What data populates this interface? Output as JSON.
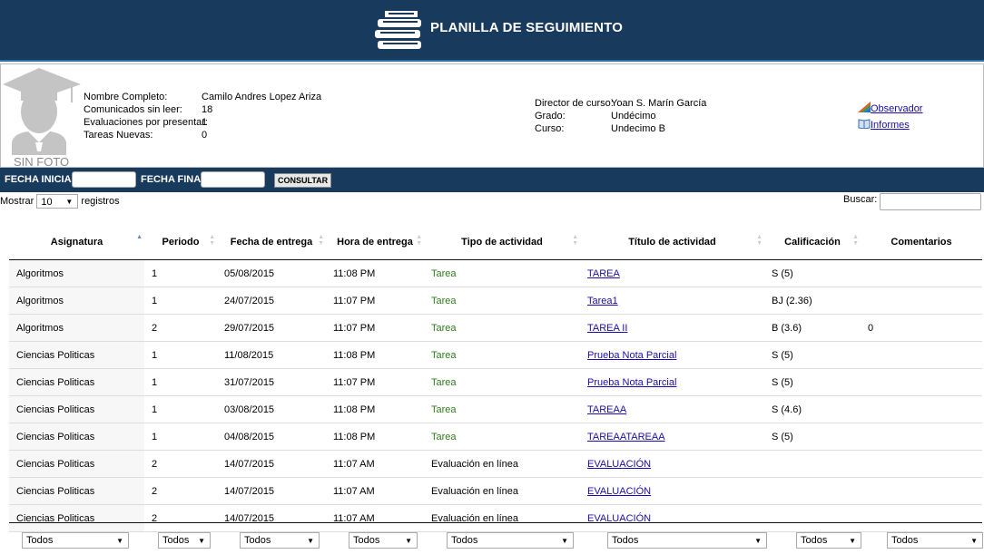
{
  "header": {
    "title": "PLANILLA DE SEGUIMIENTO",
    "logo_icon": "stacked-books-icon"
  },
  "student": {
    "photo_caption": "SIN FOTO",
    "fields": [
      {
        "label": "Nombre Completo:",
        "value": "Camilo Andres Lopez Ariza"
      },
      {
        "label": "Comunicados sin leer:",
        "value": "18"
      },
      {
        "label": "Evaluaciones por presentar:",
        "value": "1"
      },
      {
        "label": "Tareas Nuevas:",
        "value": "0"
      }
    ]
  },
  "course": {
    "fields": [
      {
        "label": "Director de curso:",
        "value": "Yoan S. Marín García"
      },
      {
        "label": "Grado:",
        "value": "Undécimo"
      },
      {
        "label": "Curso:",
        "value": "Undecimo B"
      }
    ]
  },
  "links": {
    "observador": "Observador",
    "informes": "Informes"
  },
  "filters": {
    "fecha_inicial_label": "FECHA INICIAL:",
    "fecha_final_label": "FECHA FINAL:",
    "fecha_inicial_value": "",
    "fecha_final_value": "",
    "consultar_label": "CONSULTAR"
  },
  "table_controls": {
    "show_prefix": "Mostrar",
    "page_length": "10",
    "show_suffix": "registros",
    "search_label": "Buscar:",
    "search_value": ""
  },
  "table": {
    "columns": [
      "Asignatura",
      "Periodo",
      "Fecha de entrega",
      "Hora de entrega",
      "Tipo de actividad",
      "Título de actividad",
      "Calificación",
      "Comentarios"
    ],
    "sorted_column": "Asignatura",
    "rows": [
      {
        "asignatura": "Algoritmos",
        "periodo": "1",
        "fecha": "05/08/2015",
        "hora": "11:08 PM",
        "tipo": "Tarea",
        "titulo": "TAREA",
        "calificacion": "S (5)",
        "comentarios": ""
      },
      {
        "asignatura": "Algoritmos",
        "periodo": "1",
        "fecha": "24/07/2015",
        "hora": "11:07 PM",
        "tipo": "Tarea",
        "titulo": "Tarea1",
        "calificacion": "BJ (2.36)",
        "comentarios": ""
      },
      {
        "asignatura": "Algoritmos",
        "periodo": "2",
        "fecha": "29/07/2015",
        "hora": "11:07 PM",
        "tipo": "Tarea",
        "titulo": "TAREA II",
        "calificacion": "B (3.6)",
        "comentarios": "0"
      },
      {
        "asignatura": "Ciencias Politicas",
        "periodo": "1",
        "fecha": "11/08/2015",
        "hora": "11:08 PM",
        "tipo": "Tarea",
        "titulo": "Prueba Nota Parcial",
        "calificacion": "S (5)",
        "comentarios": ""
      },
      {
        "asignatura": "Ciencias Politicas",
        "periodo": "1",
        "fecha": "31/07/2015",
        "hora": "11:07 PM",
        "tipo": "Tarea",
        "titulo": "Prueba Nota Parcial",
        "calificacion": "S (5)",
        "comentarios": ""
      },
      {
        "asignatura": "Ciencias Politicas",
        "periodo": "1",
        "fecha": "03/08/2015",
        "hora": "11:08 PM",
        "tipo": "Tarea",
        "titulo": "TAREAA",
        "calificacion": "S (4.6)",
        "comentarios": ""
      },
      {
        "asignatura": "Ciencias Politicas",
        "periodo": "1",
        "fecha": "04/08/2015",
        "hora": "11:08 PM",
        "tipo": "Tarea",
        "titulo": "TAREAATAREAA",
        "calificacion": "S (5)",
        "comentarios": ""
      },
      {
        "asignatura": "Ciencias Politicas",
        "periodo": "2",
        "fecha": "14/07/2015",
        "hora": "11:07 AM",
        "tipo": "Evaluación en línea",
        "titulo": "EVALUACIÓN",
        "calificacion": "",
        "comentarios": ""
      },
      {
        "asignatura": "Ciencias Politicas",
        "periodo": "2",
        "fecha": "14/07/2015",
        "hora": "11:07 AM",
        "tipo": "Evaluación en línea",
        "titulo": "EVALUACIÓN",
        "calificacion": "",
        "comentarios": ""
      },
      {
        "asignatura": "Ciencias Politicas",
        "periodo": "2",
        "fecha": "14/07/2015",
        "hora": "11:07 AM",
        "tipo": "Evaluación en línea",
        "titulo": "EVALUACIÓN",
        "calificacion": "",
        "comentarios": ""
      }
    ],
    "footer_filters": [
      "Todos",
      "Todos",
      "Todos",
      "Todos",
      "Todos",
      "Todos",
      "Todos",
      "Todos"
    ]
  },
  "colors": {
    "header_bg": "#183a5c",
    "tarea_text": "#2e7d1c",
    "link": "#1a0dab"
  }
}
